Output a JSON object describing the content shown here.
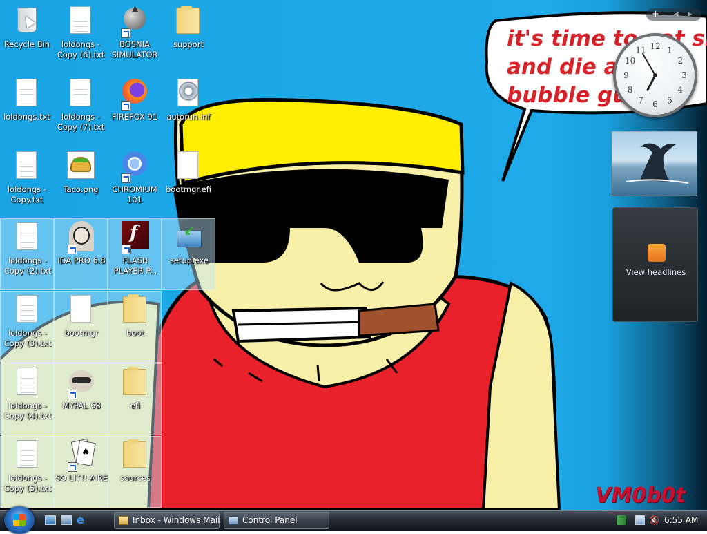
{
  "desktop": {
    "wallpaper_caption": "it's time to eat shi\nand die an\nbubble gu",
    "wallpaper_signature": "VM0b0t",
    "icons": [
      {
        "label": "Recycle Bin",
        "name": "recycle-bin-icon"
      },
      {
        "label": "loldongs - Copy (6).txt",
        "name": "text-file-icon"
      },
      {
        "label": "BOSNIA SIMULATOR",
        "name": "spiked-ball-icon"
      },
      {
        "label": "support",
        "name": "folder-icon"
      },
      {
        "label": "loldongs.txt",
        "name": "text-file-icon"
      },
      {
        "label": "loldongs - Copy (7).txt",
        "name": "text-file-icon"
      },
      {
        "label": "FIREFOX 91",
        "name": "firefox-icon"
      },
      {
        "label": "autorun.inf",
        "name": "settings-file-icon"
      },
      {
        "label": "loldongs - Copy.txt",
        "name": "text-file-icon"
      },
      {
        "label": "Taco.png",
        "name": "taco-image-icon"
      },
      {
        "label": "CHROMIUM 101",
        "name": "chromium-icon"
      },
      {
        "label": "bootmgr.efi",
        "name": "blank-file-icon"
      },
      {
        "label": "loldongs - Copy (2).txt",
        "name": "text-file-icon"
      },
      {
        "label": "IDA PRO 6.8",
        "name": "ida-pro-icon"
      },
      {
        "label": "FLASH PLAYER P...",
        "name": "flash-player-icon"
      },
      {
        "label": "setup.exe",
        "name": "setup-installer-icon"
      },
      {
        "label": "loldongs - Copy (3).txt",
        "name": "text-file-icon"
      },
      {
        "label": "bootmgr",
        "name": "blank-file-icon"
      },
      {
        "label": "boot",
        "name": "folder-icon"
      },
      {
        "label": "loldongs - Copy (4).txt",
        "name": "text-file-icon"
      },
      {
        "label": "MYPAL 68",
        "name": "raccoon-browser-icon"
      },
      {
        "label": "efi",
        "name": "folder-icon"
      },
      {
        "label": "loldongs - Copy (5).txt",
        "name": "text-file-icon"
      },
      {
        "label": "SO LIT!! AIRE",
        "name": "playing-cards-icon"
      },
      {
        "label": "sources",
        "name": "folder-icon"
      }
    ]
  },
  "gadgets": {
    "clock": {
      "numerals": [
        "12",
        "1",
        "2",
        "3",
        "4",
        "5",
        "6",
        "7",
        "8",
        "9",
        "10",
        "11"
      ],
      "time": "6:55"
    },
    "slideshow": {
      "subject": "whale tail photo"
    },
    "feed": {
      "label": "View headlines"
    }
  },
  "taskbar": {
    "tasks": [
      {
        "label": "Inbox - Windows Mail",
        "name": "taskbar-button-windows-mail"
      },
      {
        "label": "Control Panel",
        "name": "taskbar-button-control-panel"
      }
    ],
    "clock": "6:55 AM"
  },
  "colors": {
    "wallpaper_blue": "#1fa9e8",
    "caption_red": "#d6232a",
    "taskbar_dark": "#262d35"
  }
}
